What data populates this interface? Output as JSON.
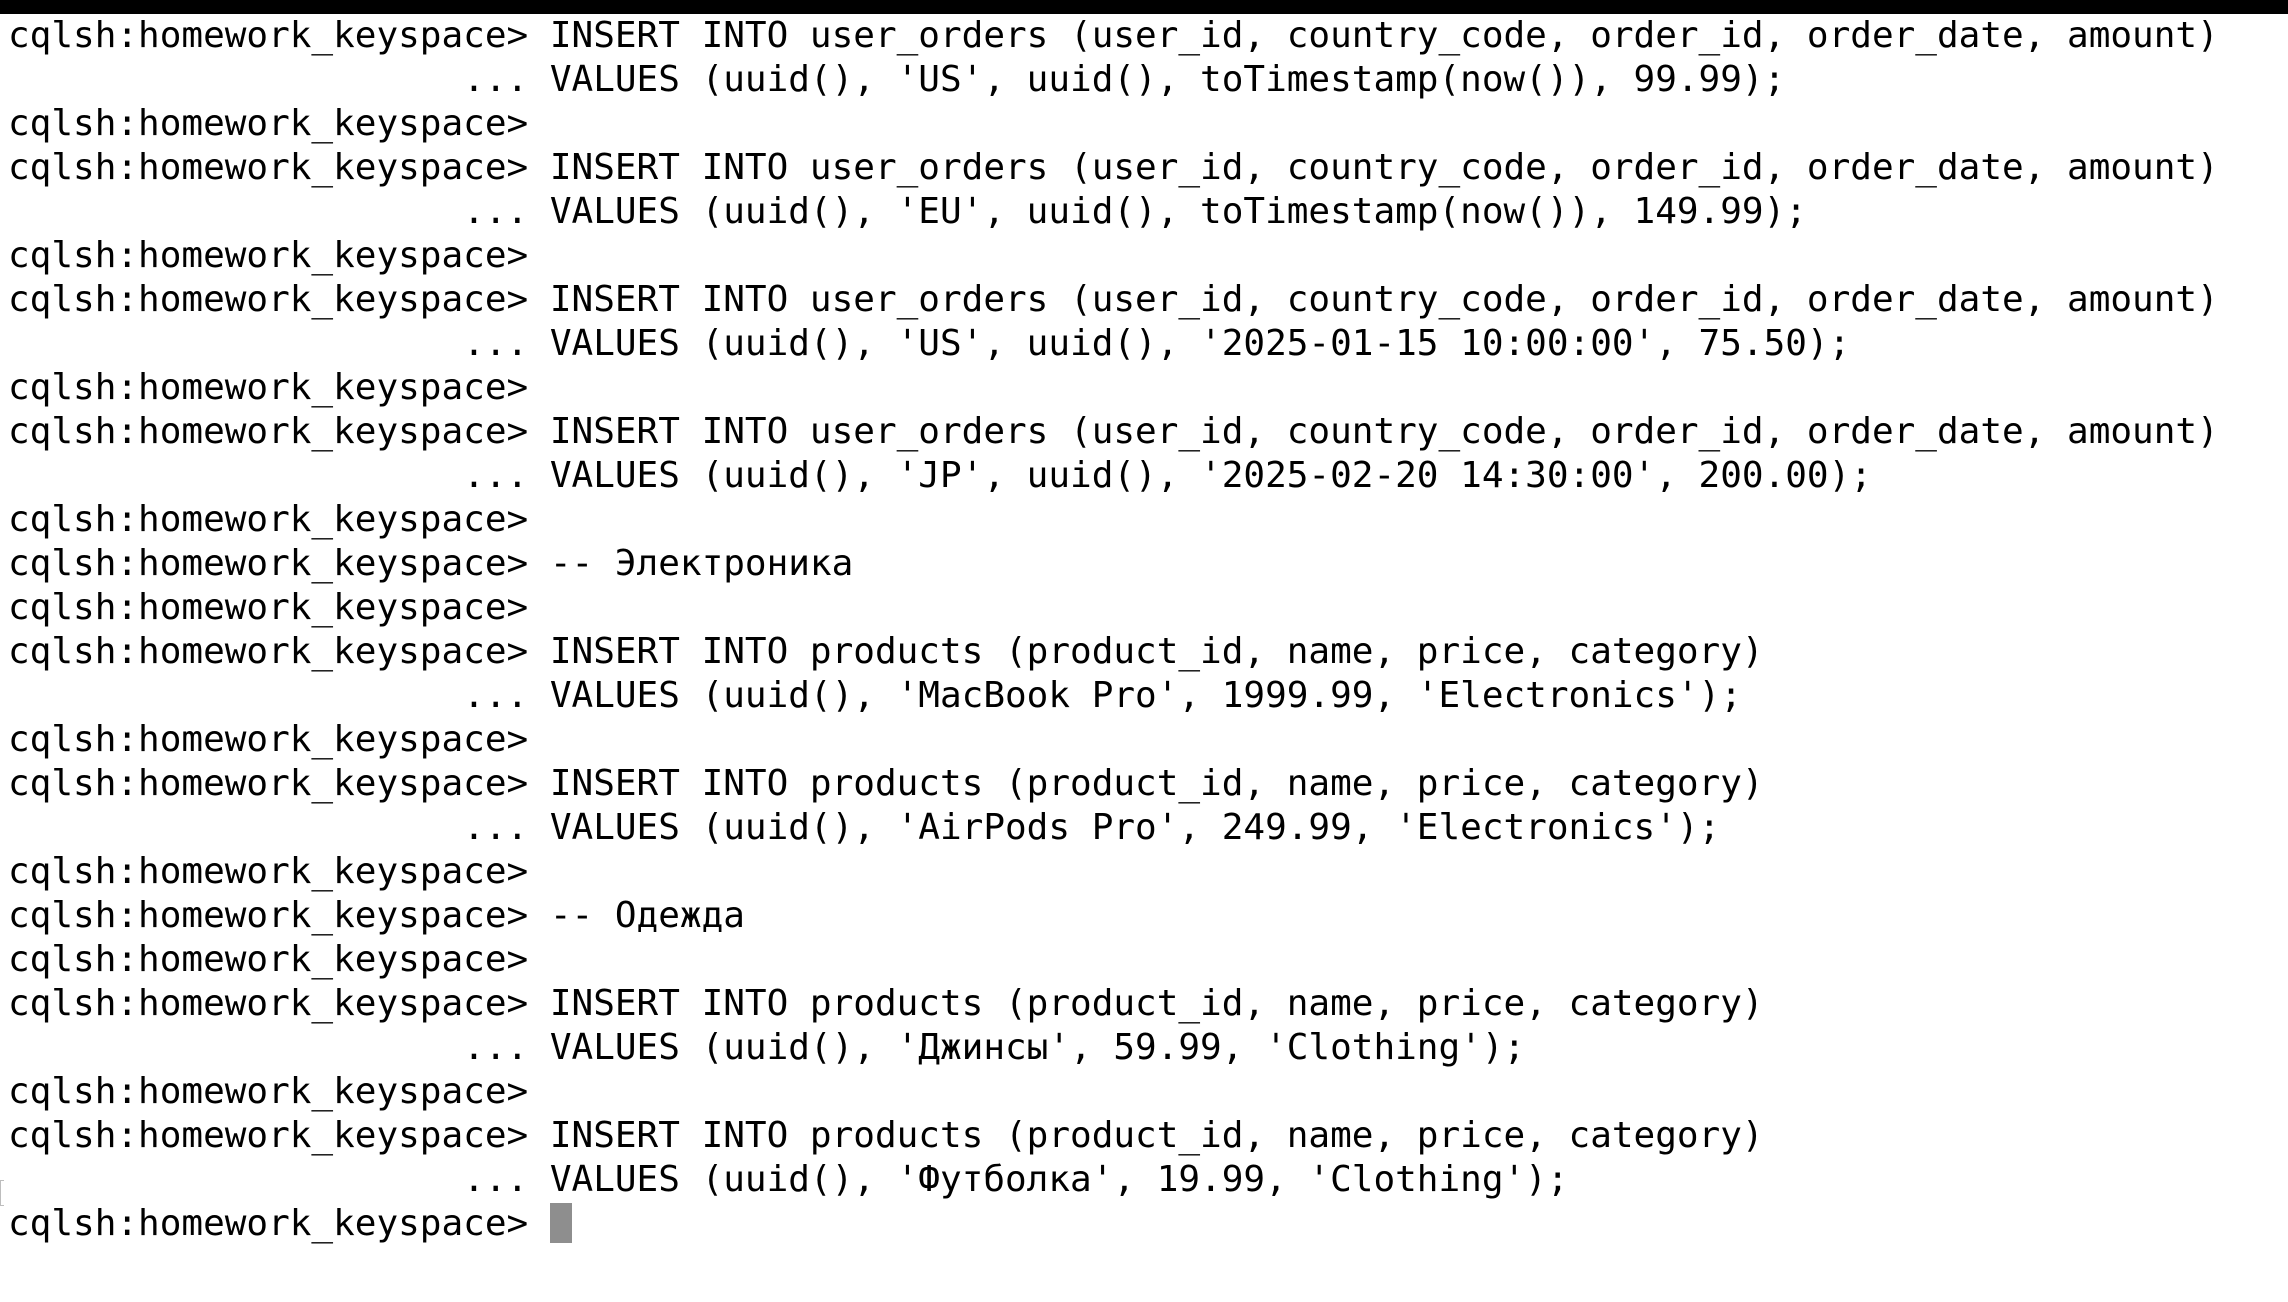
{
  "terminal": {
    "lines": [
      "cqlsh:homework_keyspace> INSERT INTO user_orders (user_id, country_code, order_id, order_date, amount)",
      "                     ... VALUES (uuid(), 'US', uuid(), toTimestamp(now()), 99.99);",
      "cqlsh:homework_keyspace>",
      "cqlsh:homework_keyspace> INSERT INTO user_orders (user_id, country_code, order_id, order_date, amount)",
      "                     ... VALUES (uuid(), 'EU', uuid(), toTimestamp(now()), 149.99);",
      "cqlsh:homework_keyspace>",
      "cqlsh:homework_keyspace> INSERT INTO user_orders (user_id, country_code, order_id, order_date, amount)",
      "                     ... VALUES (uuid(), 'US', uuid(), '2025-01-15 10:00:00', 75.50);",
      "cqlsh:homework_keyspace>",
      "cqlsh:homework_keyspace> INSERT INTO user_orders (user_id, country_code, order_id, order_date, amount)",
      "                     ... VALUES (uuid(), 'JP', uuid(), '2025-02-20 14:30:00', 200.00);",
      "cqlsh:homework_keyspace>",
      "cqlsh:homework_keyspace> -- Электроника",
      "cqlsh:homework_keyspace>",
      "cqlsh:homework_keyspace> INSERT INTO products (product_id, name, price, category)",
      "                     ... VALUES (uuid(), 'MacBook Pro', 1999.99, 'Electronics');",
      "cqlsh:homework_keyspace>",
      "cqlsh:homework_keyspace> INSERT INTO products (product_id, name, price, category)",
      "                     ... VALUES (uuid(), 'AirPods Pro', 249.99, 'Electronics');",
      "cqlsh:homework_keyspace>",
      "cqlsh:homework_keyspace> -- Одежда",
      "cqlsh:homework_keyspace>",
      "cqlsh:homework_keyspace> INSERT INTO products (product_id, name, price, category)",
      "                     ... VALUES (uuid(), 'Джинсы', 59.99, 'Clothing');",
      "cqlsh:homework_keyspace>",
      "cqlsh:homework_keyspace> INSERT INTO products (product_id, name, price, category)",
      "                     ... VALUES (uuid(), 'Футболка', 19.99, 'Clothing');",
      "cqlsh:homework_keyspace> "
    ],
    "colors": {
      "background": "#ffffff",
      "text": "#000000",
      "cursor": "#8e8e8e",
      "top_bar": "#000000"
    }
  }
}
